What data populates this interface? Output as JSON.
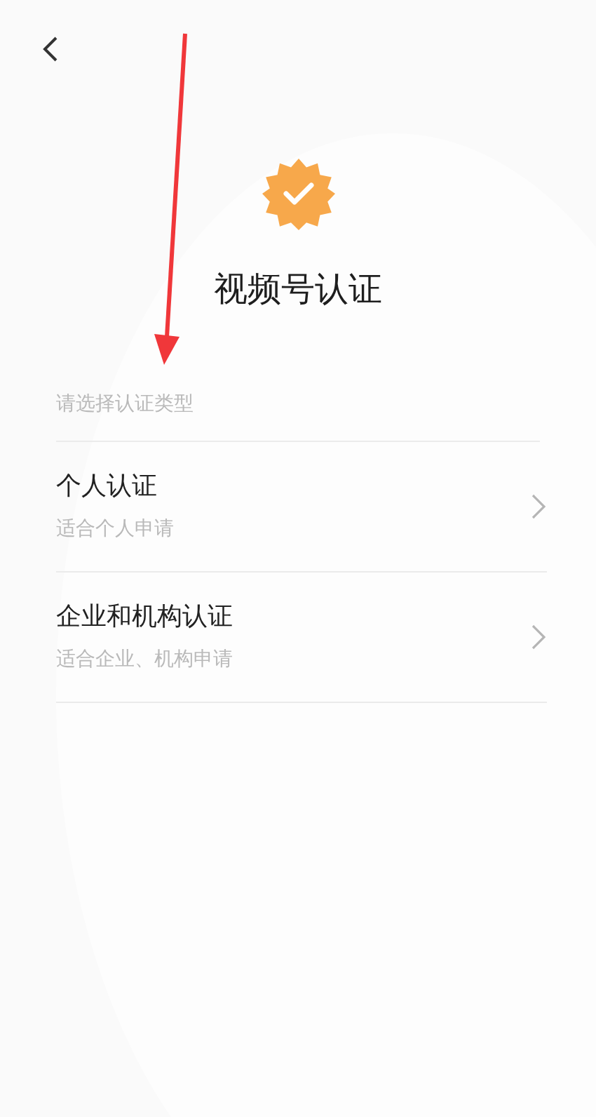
{
  "title": "视频号认证",
  "section_label": "请选择认证类型",
  "options": [
    {
      "title": "个人认证",
      "subtitle": "适合个人申请"
    },
    {
      "title": "企业和机构认证",
      "subtitle": "适合企业、机构申请"
    }
  ]
}
